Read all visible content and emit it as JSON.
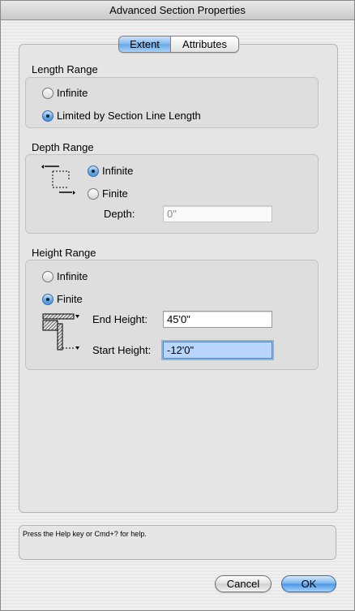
{
  "window": {
    "title": "Advanced Section Properties"
  },
  "tabs": [
    {
      "label": "Extent",
      "active": true
    },
    {
      "label": "Attributes",
      "active": false
    }
  ],
  "length_range": {
    "title": "Length Range",
    "options": [
      {
        "label": "Infinite",
        "selected": false
      },
      {
        "label": "Limited by Section Line Length",
        "selected": true
      }
    ]
  },
  "depth_range": {
    "title": "Depth Range",
    "options": [
      {
        "label": "Infinite",
        "selected": true
      },
      {
        "label": "Finite",
        "selected": false
      }
    ],
    "depth_label": "Depth:",
    "depth_value": "0\""
  },
  "height_range": {
    "title": "Height Range",
    "options": [
      {
        "label": "Infinite",
        "selected": false
      },
      {
        "label": "Finite",
        "selected": true
      }
    ],
    "end_height_label": "End Height:",
    "end_height_value": "45'0\"",
    "start_height_label": "Start Height:",
    "start_height_value": "-12'0\""
  },
  "help": {
    "text": "Press the Help key or Cmd+? for help."
  },
  "buttons": {
    "cancel": "Cancel",
    "ok": "OK"
  },
  "colors": {
    "accent": "#65a7e8",
    "focus": "#b6d6fb"
  }
}
